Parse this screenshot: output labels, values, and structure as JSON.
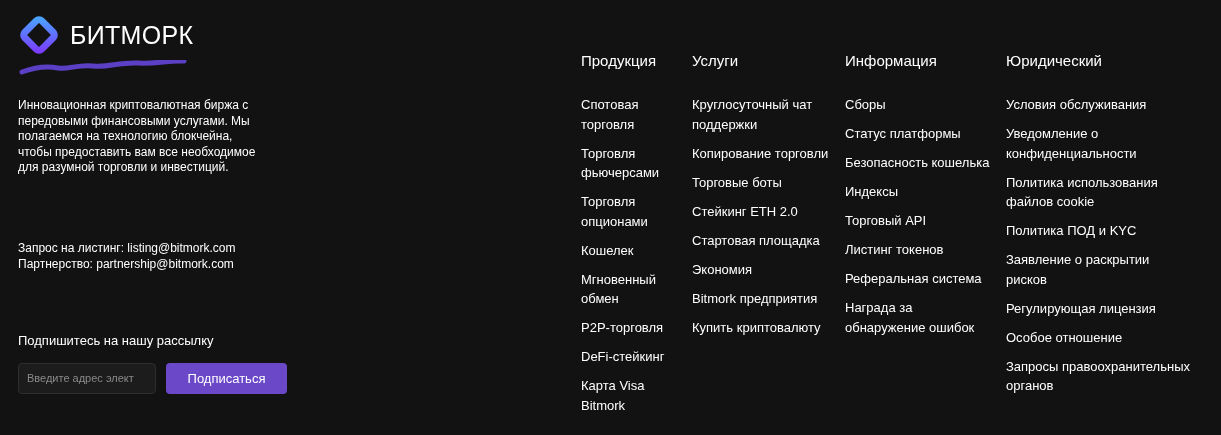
{
  "brand": {
    "name": "БИТМОРК"
  },
  "description": "Инновационная криптовалютная биржа с передовыми финансовыми услугами. Мы полагаемся на технологию блокчейна, чтобы предоставить вам все необходимое для разумной торговли и инвестиций.",
  "contacts": [
    "Запрос на листинг: listing@bitmork.com",
    "Партнерство: partnership@bitmork.com"
  ],
  "newsletter": {
    "title": "Подпишитесь на нашу рассылку",
    "placeholder": "Введите адрес элект",
    "button": "Подписаться"
  },
  "columns": [
    {
      "title": "Продукция",
      "links": [
        "Спотовая торговля",
        "Торговля фьючерсами",
        "Торговля опционами",
        "Кошелек",
        "Мгновенный обмен",
        "P2P-торговля",
        "DeFi-стейкинг",
        "Карта Visa Bitmork"
      ]
    },
    {
      "title": "Услуги",
      "links": [
        "Круглосуточный чат поддержки",
        "Копирование торговли",
        "Торговые боты",
        "Стейкинг ETH 2.0",
        "Стартовая площадка",
        "Экономия",
        "Bitmork предприятия",
        "Купить криптовалюту"
      ]
    },
    {
      "title": "Информация",
      "links": [
        "Сборы",
        "Статус платформы",
        "Безопасность кошелька",
        "Индексы",
        "Торговый API",
        "Листинг токенов",
        "Реферальная система",
        "Награда за обнаружение ошибок"
      ]
    },
    {
      "title": "Юридический",
      "links": [
        "Условия обслуживания",
        "Уведомление о конфиденциальности",
        "Политика использования файлов cookie",
        "Политика ПОД и KYC",
        "Заявление о раскрытии рисков",
        "Регулирующая лицензия",
        "Особое отношение",
        "Запросы правоохранительных органов"
      ]
    }
  ]
}
